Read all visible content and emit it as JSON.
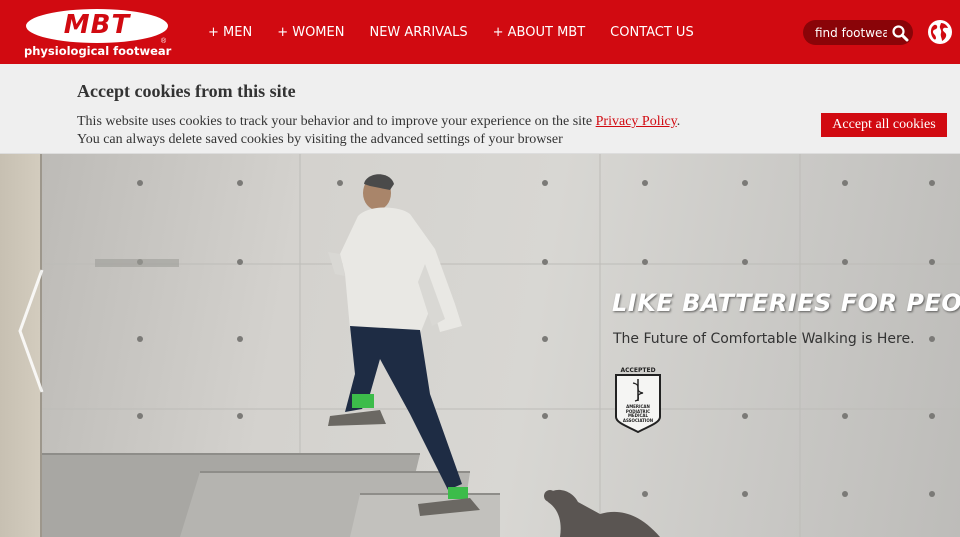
{
  "header": {
    "logo_text": "MBT",
    "logo_registered": "®",
    "logo_tagline": "physiological footwear",
    "nav": [
      {
        "label": "+ MEN"
      },
      {
        "label": "+ WOMEN"
      },
      {
        "label": "NEW ARRIVALS"
      },
      {
        "label": "+ ABOUT MBT"
      },
      {
        "label": "CONTACT US"
      }
    ],
    "search_placeholder": "find footwear",
    "search_icon": "search-icon",
    "globe_icon": "globe-icon"
  },
  "cookie_banner": {
    "title": "Accept cookies from this site",
    "text_before_link": "This website uses cookies to track your behavior and to improve your experience on the site ",
    "link_label": "Privacy Policy",
    "text_after_link": ".",
    "text_line2": "You can always delete saved cookies by visiting the advanced settings of your browser",
    "accept_button": "Accept all cookies"
  },
  "hero": {
    "heading": "LIKE BATTERIES FOR PEOPLE",
    "subheading": "The Future of Comfortable Walking is Here.",
    "badge_top": "ACCEPTED",
    "badge_bottom": "AMERICAN PODIATRIC MEDICAL ASSOCIATION",
    "prev_arrow_icon": "chevron-left-icon"
  },
  "colors": {
    "brand_red": "#d10a11",
    "search_bg": "#8a0408",
    "banner_bg": "#efefef"
  }
}
